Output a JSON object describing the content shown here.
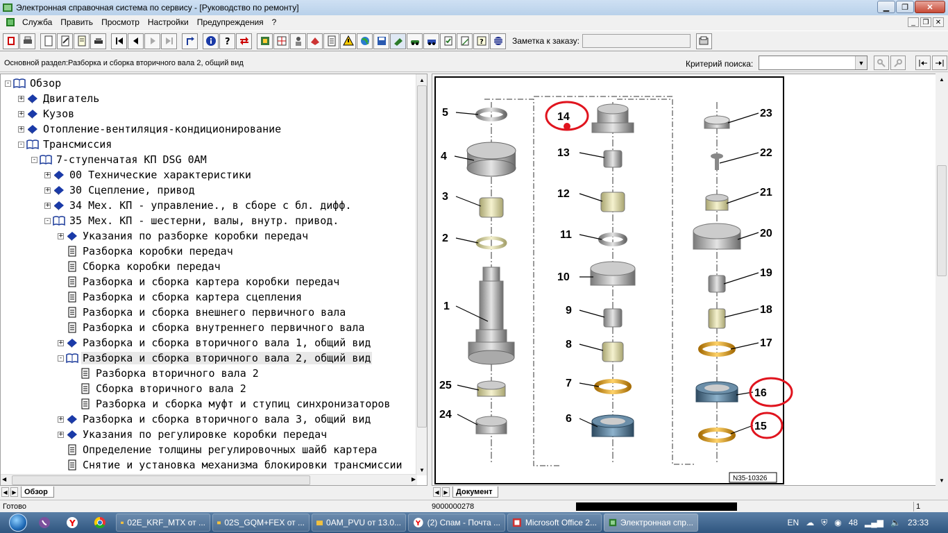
{
  "window": {
    "title": "Электронная справочная система по сервису - [Руководство по ремонту]"
  },
  "menu": [
    "Служба",
    "Править",
    "Просмотр",
    "Настройки",
    "Предупреждения",
    "?"
  ],
  "toolbar": {
    "note_label": "Заметка к заказу:",
    "note_value": ""
  },
  "infobar": {
    "section": "Основной раздел:Разборка и сборка вторичного вала 2, общий вид",
    "criteria_label": "Критерий  поиска:",
    "criteria_value": ""
  },
  "tree": [
    {
      "label": "Обзор",
      "level": 0,
      "exp": "-",
      "icon": "book-open-icon"
    },
    {
      "label": "Двигатель",
      "level": 1,
      "exp": "+",
      "icon": "book-closed-icon"
    },
    {
      "label": "Кузов",
      "level": 1,
      "exp": "+",
      "icon": "book-closed-icon"
    },
    {
      "label": "Отопление-вентиляция-кондиционирование",
      "level": 1,
      "exp": "+",
      "icon": "book-closed-icon"
    },
    {
      "label": "Трансмиссия",
      "level": 1,
      "exp": "-",
      "icon": "book-open-icon"
    },
    {
      "label": "7-ступенчатая КП DSG 0AM",
      "level": 2,
      "exp": "-",
      "icon": "book-open-icon"
    },
    {
      "label": "00 Технические характеристики",
      "level": 3,
      "exp": "+",
      "icon": "book-closed-icon"
    },
    {
      "label": "30 Сцепление, привод",
      "level": 3,
      "exp": "+",
      "icon": "book-closed-icon"
    },
    {
      "label": "34 Мех. КП - управление., в сборе с бл. дифф.",
      "level": 3,
      "exp": "+",
      "icon": "book-closed-icon"
    },
    {
      "label": "35 Мех. КП - шестерни, валы, внутр. привод.",
      "level": 3,
      "exp": "-",
      "icon": "book-open-icon"
    },
    {
      "label": "Указания по разборке коробки передач",
      "level": 4,
      "exp": "+",
      "icon": "book-closed-icon"
    },
    {
      "label": "Разборка коробки передач",
      "level": 4,
      "exp": "",
      "icon": "document-icon"
    },
    {
      "label": "Сборка коробки передач",
      "level": 4,
      "exp": "",
      "icon": "document-icon"
    },
    {
      "label": "Разборка и сборка картера коробки передач",
      "level": 4,
      "exp": "",
      "icon": "document-icon"
    },
    {
      "label": "Разборка и сборка картера сцепления",
      "level": 4,
      "exp": "",
      "icon": "document-icon"
    },
    {
      "label": "Разборка и сборка внешнего первичного вала",
      "level": 4,
      "exp": "",
      "icon": "document-icon"
    },
    {
      "label": "Разборка и сборка внутреннего первичного вала",
      "level": 4,
      "exp": "",
      "icon": "document-icon"
    },
    {
      "label": "Разборка и сборка вторичного вала 1, общий вид",
      "level": 4,
      "exp": "+",
      "icon": "book-closed-icon"
    },
    {
      "label": "Разборка и сборка вторичного вала 2, общий вид",
      "level": 4,
      "exp": "-",
      "icon": "book-open-icon",
      "selected": true
    },
    {
      "label": "Разборка вторичного вала 2",
      "level": 5,
      "exp": "",
      "icon": "document-icon"
    },
    {
      "label": "Сборка вторичного вала 2",
      "level": 5,
      "exp": "",
      "icon": "document-icon"
    },
    {
      "label": "Разборка и сборка муфт и ступиц синхронизаторов",
      "level": 5,
      "exp": "",
      "icon": "document-icon"
    },
    {
      "label": "Разборка и сборка вторичного вала 3, общий вид",
      "level": 4,
      "exp": "+",
      "icon": "book-closed-icon"
    },
    {
      "label": "Указания по регулировке коробки передач",
      "level": 4,
      "exp": "+",
      "icon": "book-closed-icon"
    },
    {
      "label": "Определение толщины регулировочных шайб картера",
      "level": 4,
      "exp": "",
      "icon": "document-icon"
    },
    {
      "label": "Снятие и установка механизма блокировки трансмиссии",
      "level": 4,
      "exp": "",
      "icon": "document-icon"
    }
  ],
  "tabs": {
    "left": "Обзор",
    "right": "Документ"
  },
  "diagram": {
    "ref": "N35-10326",
    "labels": [
      "1",
      "2",
      "3",
      "4",
      "5",
      "6",
      "7",
      "8",
      "9",
      "10",
      "11",
      "12",
      "13",
      "14",
      "15",
      "16",
      "17",
      "18",
      "19",
      "20",
      "21",
      "22",
      "23",
      "24",
      "25"
    ],
    "highlighted": [
      "14",
      "15",
      "16"
    ]
  },
  "status": {
    "ready": "Готово",
    "code": "9000000278",
    "page": "1"
  },
  "taskbar": {
    "tasks": [
      "02E_KRF_MTX от ...",
      "02S_GQM+FEX от ...",
      "0AM_PVU от 13.0...",
      "(2) Спам - Почта ...",
      "Microsoft Office 2...",
      "Электронная спр..."
    ],
    "lang": "EN",
    "notif": "48",
    "clock": "23:33"
  },
  "colors": {
    "highlight": "#e0141e",
    "part_steel": "#9b9b9b",
    "part_brass": "#d69a18",
    "part_bronze": "#d8d4a0",
    "part_blue": "#4a6e8a"
  }
}
